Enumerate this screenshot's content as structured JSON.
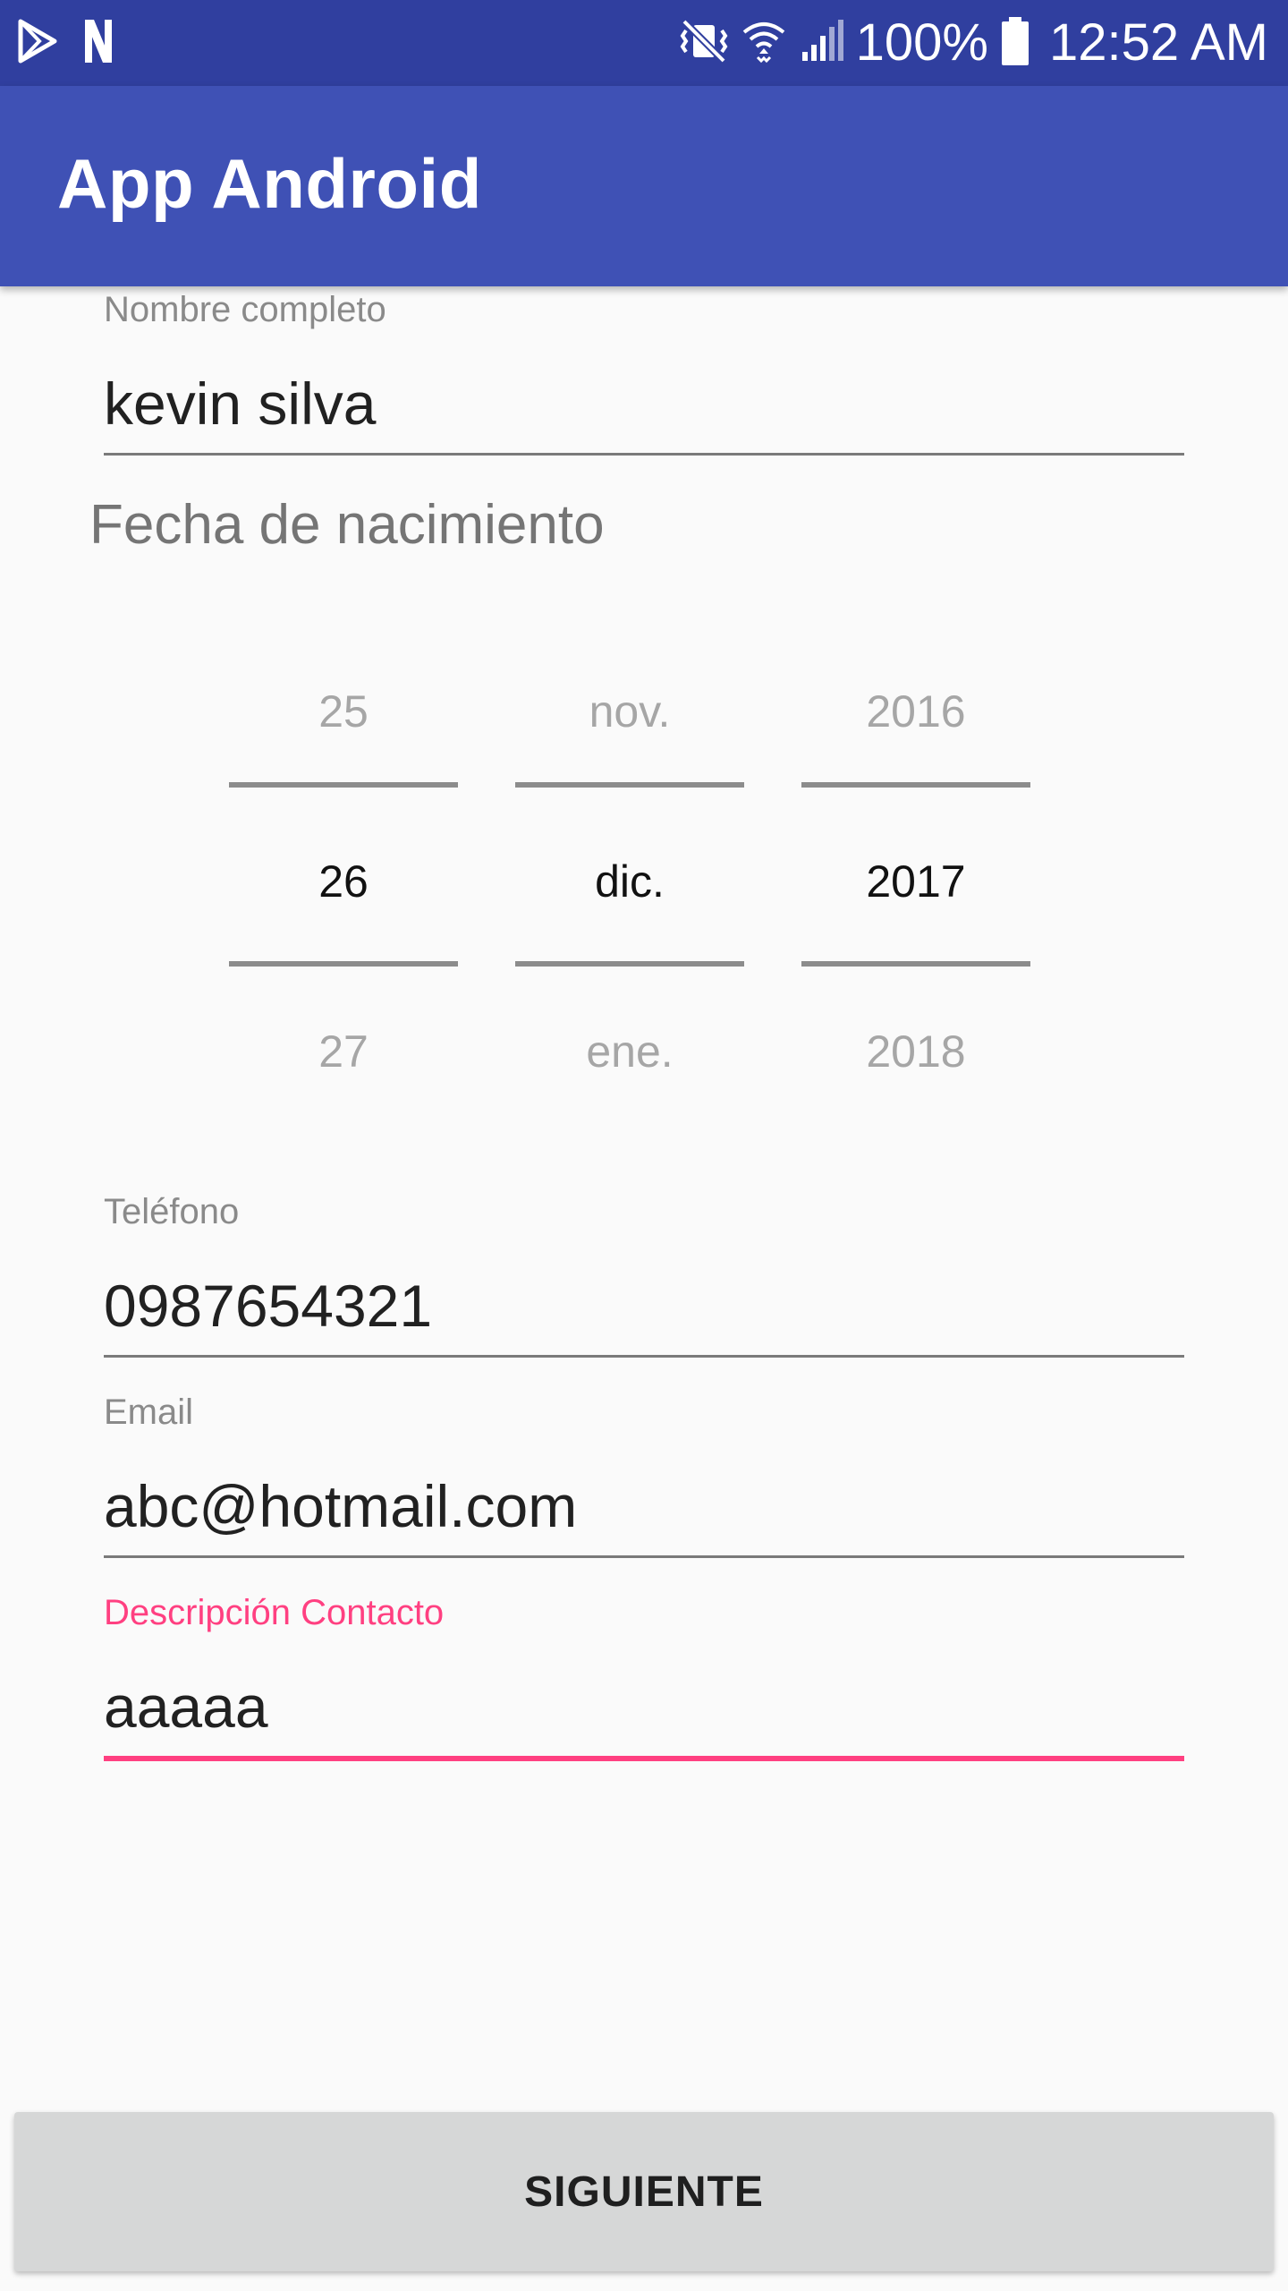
{
  "status_bar": {
    "battery_text": "100%",
    "time": "12:52 AM",
    "icons": [
      "play-store-icon",
      "notification-n-icon",
      "vibrate-mute-icon",
      "wifi-icon",
      "signal-icon",
      "battery-icon"
    ]
  },
  "app_bar": {
    "title": "App Android",
    "color": "#3f51b5",
    "status_color": "#303f9f"
  },
  "form": {
    "name": {
      "label": "Nombre completo",
      "value": "kevin silva"
    },
    "birth_date": {
      "label": "Fecha de nacimiento",
      "day": {
        "prev": "25",
        "selected": "26",
        "next": "27"
      },
      "month": {
        "prev": "nov.",
        "selected": "dic.",
        "next": "ene."
      },
      "year": {
        "prev": "2016",
        "selected": "2017",
        "next": "2018"
      }
    },
    "phone": {
      "label": "Teléfono",
      "value": "0987654321"
    },
    "email": {
      "label": "Email",
      "value": "abc@hotmail.com"
    },
    "description": {
      "label": "Descripción Contacto",
      "value": "aaaaa",
      "focused": true,
      "accent": "#ff4081"
    }
  },
  "next_button": {
    "label": "SIGUIENTE"
  }
}
